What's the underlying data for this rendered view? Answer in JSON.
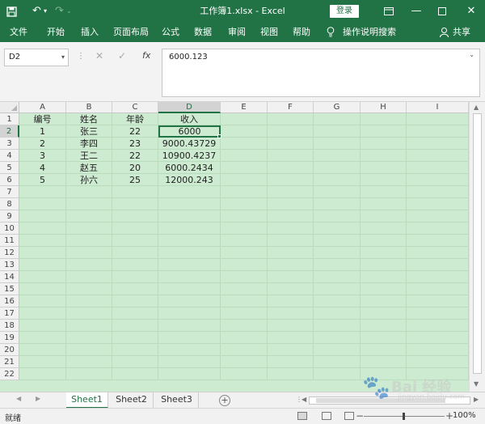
{
  "titlebar": {
    "title": "工作簿1.xlsx  -  Excel",
    "login": "登录",
    "save_icon": "save-icon",
    "undo_icon": "undo-icon",
    "redo_icon": "redo-icon"
  },
  "ribbon": {
    "tabs": [
      "文件",
      "开始",
      "插入",
      "页面布局",
      "公式",
      "数据",
      "审阅",
      "视图",
      "帮助"
    ],
    "tell_me": "操作说明搜索",
    "share": "共享"
  },
  "formula_bar": {
    "name_box": "D2",
    "fx": "fx",
    "value": "6000.123"
  },
  "columns": [
    "A",
    "B",
    "C",
    "D",
    "E",
    "F",
    "G",
    "H",
    "I"
  ],
  "row_numbers": [
    "1",
    "2",
    "3",
    "4",
    "5",
    "6",
    "7",
    "8",
    "9",
    "10",
    "11",
    "12",
    "13",
    "14",
    "15",
    "16",
    "17",
    "18",
    "19",
    "20",
    "21",
    "22"
  ],
  "table": {
    "headers": [
      "编号",
      "姓名",
      "年龄",
      "收入"
    ],
    "rows": [
      [
        "1",
        "张三",
        "22",
        "6000"
      ],
      [
        "2",
        "李四",
        "23",
        "9000.43729"
      ],
      [
        "3",
        "王二",
        "22",
        "10900.4237"
      ],
      [
        "4",
        "赵五",
        "20",
        "6000.2434"
      ],
      [
        "5",
        "孙六",
        "25",
        "12000.243"
      ]
    ]
  },
  "active_cell": "D2",
  "sheets": [
    "Sheet1",
    "Sheet2",
    "Sheet3"
  ],
  "active_sheet": "Sheet1",
  "status": {
    "ready": "就绪",
    "zoom": "100%"
  },
  "watermark": {
    "text": "Bai 经验",
    "url": "jingyan.baidu.com"
  },
  "colors": {
    "brand": "#217346",
    "cell_background": "#cdebd0"
  }
}
